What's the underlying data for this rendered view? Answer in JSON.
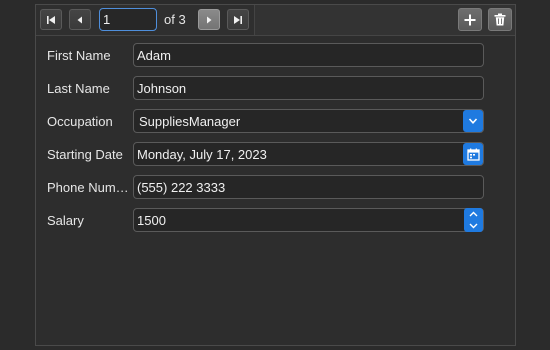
{
  "navigator": {
    "first_icon": "first-record-icon",
    "prev_icon": "previous-record-icon",
    "page_value": "1",
    "of_label": "of 3",
    "next_icon": "next-record-icon",
    "last_icon": "last-record-icon",
    "add_icon": "plus-icon",
    "delete_icon": "trash-icon"
  },
  "form": {
    "fields": [
      {
        "label": "First Name",
        "value": "Adam"
      },
      {
        "label": "Last Name",
        "value": "Johnson"
      },
      {
        "label": "Occupation",
        "value": "SuppliesManager"
      },
      {
        "label": "Starting Date",
        "value": "Monday, July 17, 2023"
      },
      {
        "label": "Phone  Number",
        "value": "(555) 222 3333"
      },
      {
        "label": "Salary",
        "value": "1500"
      }
    ]
  },
  "colors": {
    "accent": "#1f7ae0",
    "focus_border": "#4f8fdc",
    "background": "#2b2b2b"
  }
}
